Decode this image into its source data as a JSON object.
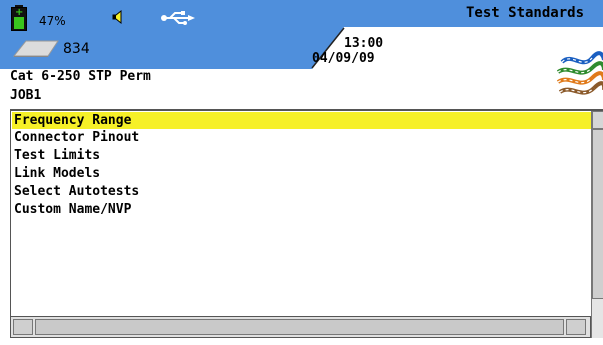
{
  "status": {
    "battery_percent": "47%",
    "battery_level": 0.47,
    "disk_count": "834",
    "time": "13:00",
    "date": "04/09/09",
    "title": "Test Standards"
  },
  "header": {
    "test_standard": "Cat 6-250 STP Perm",
    "job": "JOB1"
  },
  "menu": {
    "items": [
      {
        "label": "Frequency Range",
        "selected": true
      },
      {
        "label": "Connector Pinout",
        "selected": false
      },
      {
        "label": "Test Limits",
        "selected": false
      },
      {
        "label": "Link Models",
        "selected": false
      },
      {
        "label": "Select Autotests",
        "selected": false
      },
      {
        "label": "Custom Name/NVP",
        "selected": false
      }
    ]
  },
  "icons": {
    "battery": "battery-icon",
    "speaker": "speaker-icon",
    "usb": "usb-icon",
    "disk": "storage-disk-icon",
    "cable": "cable-logo-icon"
  },
  "colors": {
    "status_bar": "#4f8fdc",
    "selection": "#f6f028",
    "battery_fill": "#39c51e"
  }
}
